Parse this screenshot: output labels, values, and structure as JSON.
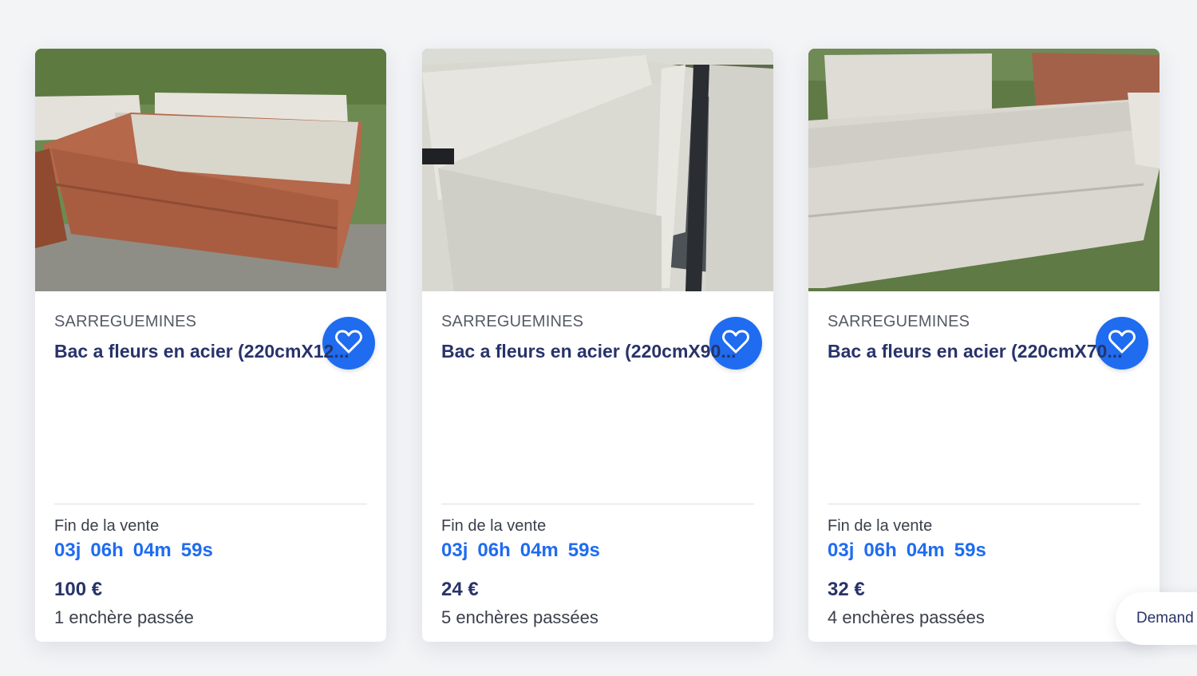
{
  "colors": {
    "accent": "#1f6cf0",
    "title": "#28336a",
    "location": "#555b66",
    "text": "#3a3f4a",
    "price": "#28336a"
  },
  "listings": [
    {
      "location": "SARREGUEMINES",
      "title": "Bac a fleurs en acier (220cmX12...",
      "end_label": "Fin de la vente",
      "countdown": {
        "days": "03j",
        "hours": "06h",
        "minutes": "04m",
        "seconds": "59s"
      },
      "price": "100 €",
      "bids": "1 enchère passée",
      "favorite_icon": "heart-icon"
    },
    {
      "location": "SARREGUEMINES",
      "title": "Bac a fleurs en acier (220cmX90...",
      "end_label": "Fin de la vente",
      "countdown": {
        "days": "03j",
        "hours": "06h",
        "minutes": "04m",
        "seconds": "59s"
      },
      "price": "24 €",
      "bids": "5 enchères passées",
      "favorite_icon": "heart-icon"
    },
    {
      "location": "SARREGUEMINES",
      "title": "Bac a fleurs en acier (220cmX70...",
      "end_label": "Fin de la vente",
      "countdown": {
        "days": "03j",
        "hours": "06h",
        "minutes": "04m",
        "seconds": "59s"
      },
      "price": "32 €",
      "bids": "4 enchères passées",
      "favorite_icon": "heart-icon"
    }
  ],
  "floating_button": {
    "label": "Demand"
  }
}
